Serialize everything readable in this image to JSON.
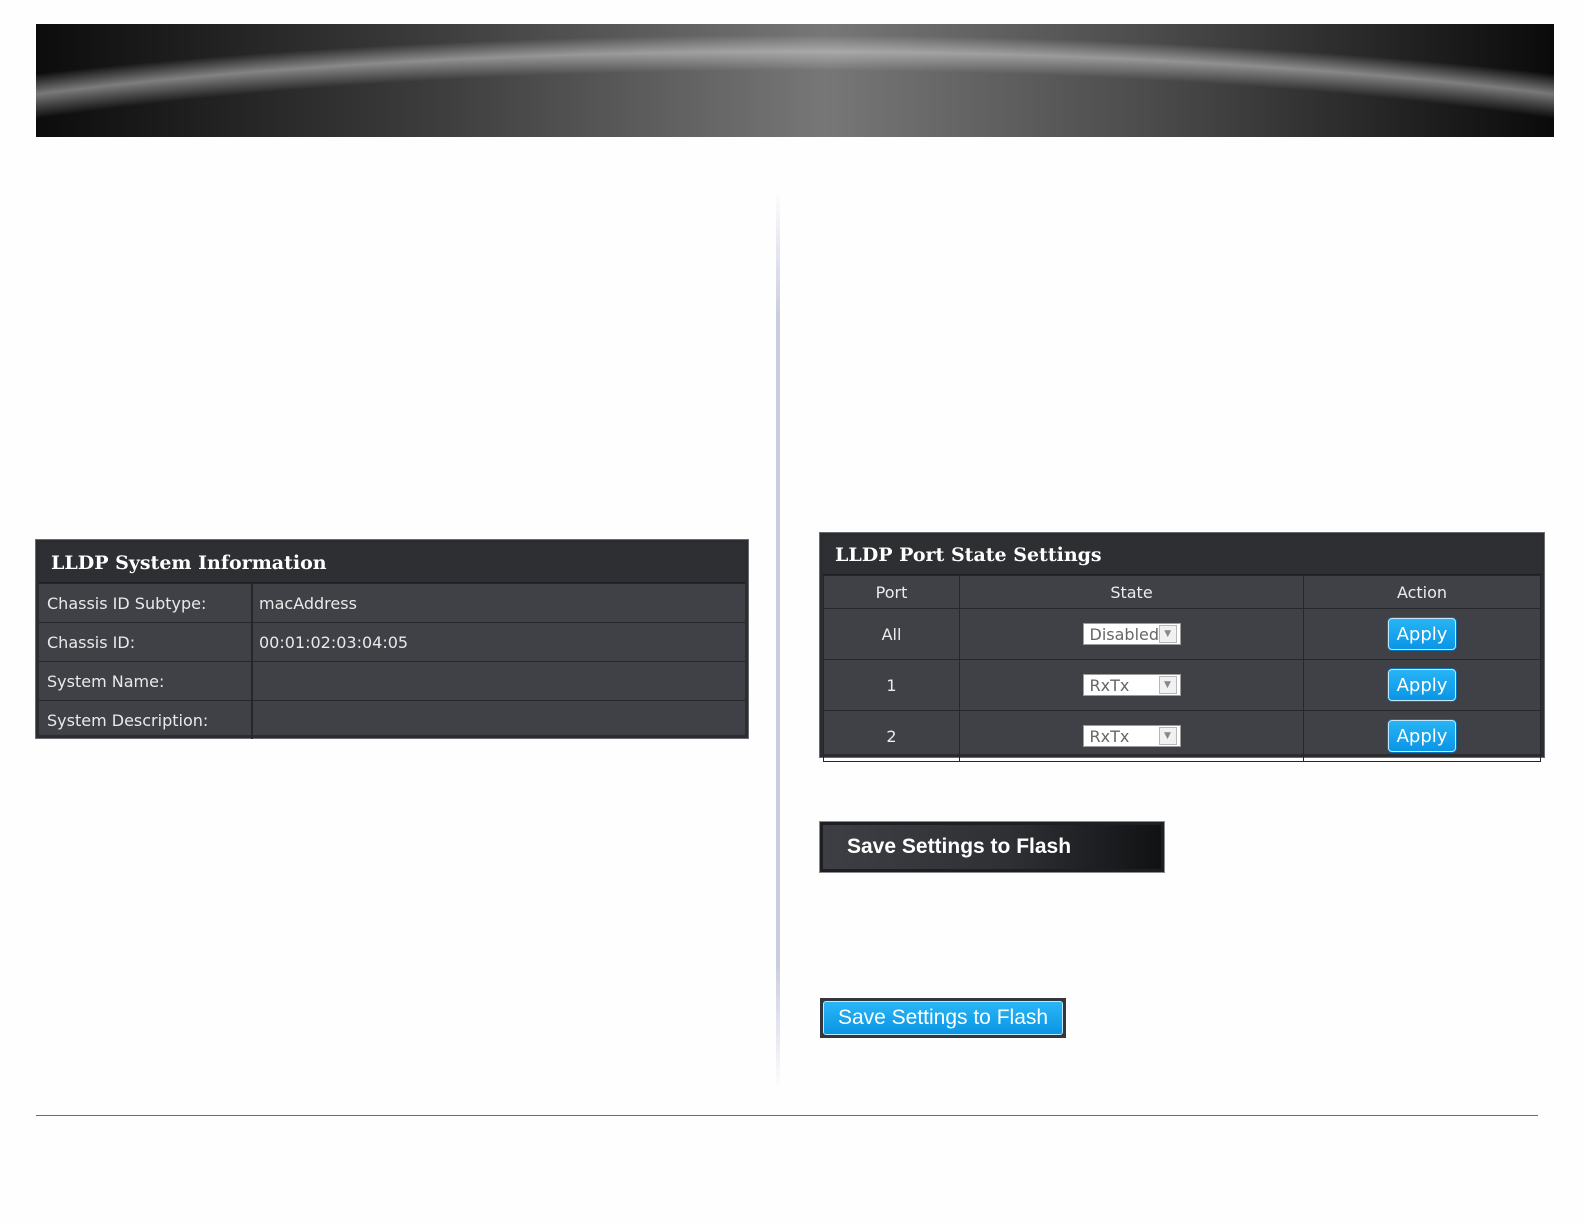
{
  "system_info": {
    "title": "LLDP System Information",
    "rows": [
      {
        "label": "Chassis ID Subtype:",
        "value": "macAddress"
      },
      {
        "label": "Chassis ID:",
        "value": "00:01:02:03:04:05"
      },
      {
        "label": "System Name:",
        "value": ""
      },
      {
        "label": "System Description:",
        "value": ""
      }
    ]
  },
  "port_state": {
    "title": "LLDP Port State Settings",
    "headers": {
      "port": "Port",
      "state": "State",
      "action": "Action"
    },
    "rows": [
      {
        "port": "All",
        "state": "Disabled",
        "action": "Apply"
      },
      {
        "port": "1",
        "state": "RxTx",
        "action": "Apply"
      },
      {
        "port": "2",
        "state": "RxTx",
        "action": "Apply"
      }
    ]
  },
  "save_dark": {
    "label": "Save Settings to Flash"
  },
  "save_blue": {
    "label": "Save Settings to Flash"
  },
  "icons": {
    "dropdown": "chevron-down-icon"
  },
  "colors": {
    "accent_blue": "#0a96e6",
    "panel_bg": "#3f4147",
    "footer_line": "#2f78c4"
  }
}
